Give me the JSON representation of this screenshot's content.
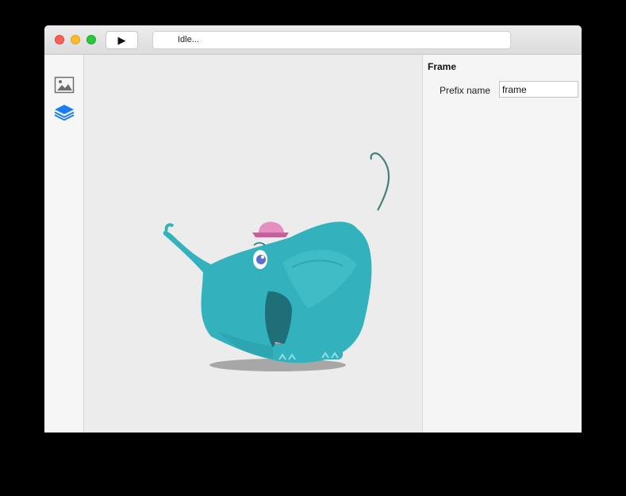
{
  "toolbar": {
    "play_icon": "play-icon",
    "play_glyph": "▶",
    "status_text": "Idle..."
  },
  "sidebar": {
    "items": [
      {
        "icon": "image-icon"
      },
      {
        "icon": "layers-icon",
        "active": true
      }
    ]
  },
  "panel": {
    "title": "Frame",
    "prefix_label": "Prefix name",
    "prefix_value": "frame"
  },
  "colors": {
    "accent": "#1a7ef2",
    "elephant_body": "#33b2bd",
    "hat": "#e58fc0"
  }
}
